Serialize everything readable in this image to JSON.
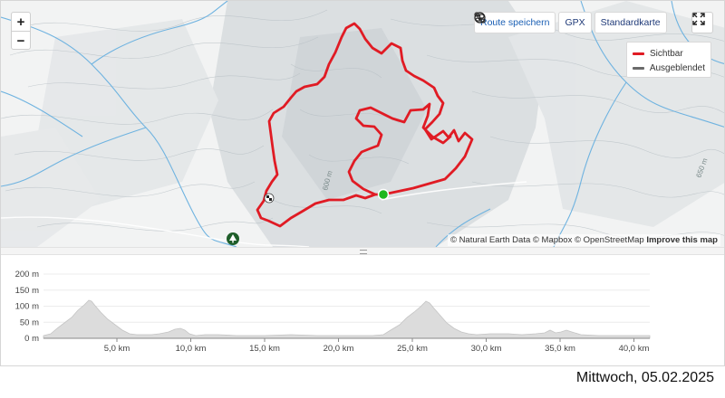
{
  "map": {
    "zoom_in_label": "+",
    "zoom_out_label": "−",
    "toolbar": {
      "save_route_label": "Route speichern",
      "gpx_label": "GPX",
      "map_style_label": "Standardkarte"
    },
    "legend": [
      {
        "label": "Sichtbar",
        "color": "#e01b24"
      },
      {
        "label": "Ausgeblendet",
        "color": "#6a6a6a"
      }
    ],
    "attribution": {
      "text": "© Natural Earth Data © Mapbox © OpenStreetMap",
      "improve_label": "Improve this map"
    },
    "contour_labels": [
      "600 m",
      "650 m"
    ],
    "route_color": "#e01b24",
    "start_color": "#1fb81f"
  },
  "elevation": {
    "y_ticks": [
      "200 m",
      "150 m",
      "100 m",
      "50 m",
      "0 m"
    ],
    "x_ticks": [
      "5,0 km",
      "10,0 km",
      "15,0 km",
      "20,0 km",
      "25,0 km",
      "30,0 km",
      "35,0 km",
      "40,0 km"
    ],
    "fill_color": "#dcdcdc"
  },
  "footer": {
    "date": "Mittwoch, 05.02.2025"
  }
}
